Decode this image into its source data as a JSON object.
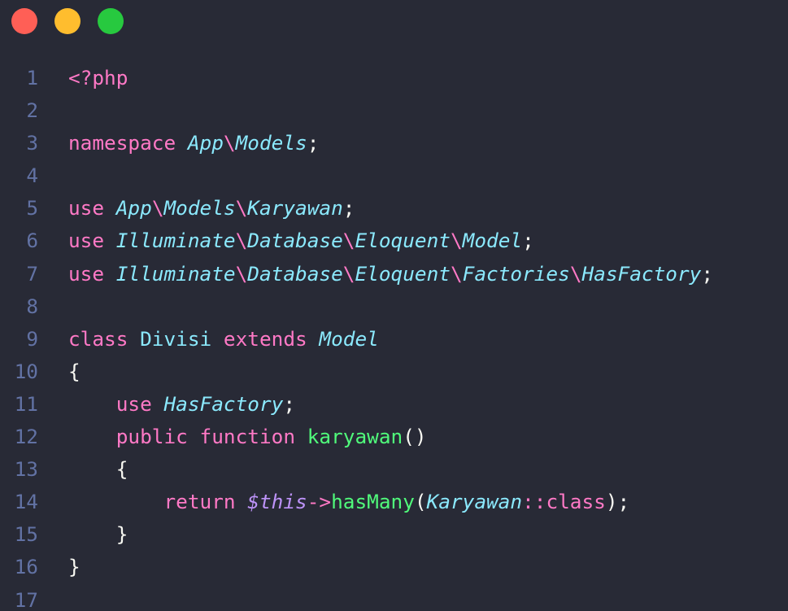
{
  "window": {
    "controls": [
      {
        "name": "close",
        "color": "#ff5f56"
      },
      {
        "name": "minimize",
        "color": "#ffbd2e"
      },
      {
        "name": "maximize",
        "color": "#27c93f"
      }
    ]
  },
  "theme": {
    "background": "#282a36",
    "line_number": "#6272a4",
    "keyword": "#ff79c6",
    "type": "#8be9fd",
    "function": "#50fa7b",
    "variable": "#bd93f9",
    "plain": "#f8f8f2"
  },
  "code": {
    "lines": [
      {
        "n": "1",
        "tokens": [
          {
            "t": "<?php",
            "k": "keyword"
          }
        ]
      },
      {
        "n": "2",
        "tokens": []
      },
      {
        "n": "3",
        "tokens": [
          {
            "t": "namespace ",
            "k": "keyword"
          },
          {
            "t": "App",
            "k": "type",
            "i": true
          },
          {
            "t": "\\",
            "k": "keyword"
          },
          {
            "t": "Models",
            "k": "type",
            "i": true
          },
          {
            "t": ";",
            "k": "plain"
          }
        ]
      },
      {
        "n": "4",
        "tokens": []
      },
      {
        "n": "5",
        "tokens": [
          {
            "t": "use ",
            "k": "keyword"
          },
          {
            "t": "App",
            "k": "type",
            "i": true
          },
          {
            "t": "\\",
            "k": "keyword"
          },
          {
            "t": "Models",
            "k": "type",
            "i": true
          },
          {
            "t": "\\",
            "k": "keyword"
          },
          {
            "t": "Karyawan",
            "k": "type",
            "i": true
          },
          {
            "t": ";",
            "k": "plain"
          }
        ]
      },
      {
        "n": "6",
        "tokens": [
          {
            "t": "use ",
            "k": "keyword"
          },
          {
            "t": "Illuminate",
            "k": "type",
            "i": true
          },
          {
            "t": "\\",
            "k": "keyword"
          },
          {
            "t": "Database",
            "k": "type",
            "i": true
          },
          {
            "t": "\\",
            "k": "keyword"
          },
          {
            "t": "Eloquent",
            "k": "type",
            "i": true
          },
          {
            "t": "\\",
            "k": "keyword"
          },
          {
            "t": "Model",
            "k": "type",
            "i": true
          },
          {
            "t": ";",
            "k": "plain"
          }
        ]
      },
      {
        "n": "7",
        "tokens": [
          {
            "t": "use ",
            "k": "keyword"
          },
          {
            "t": "Illuminate",
            "k": "type",
            "i": true
          },
          {
            "t": "\\",
            "k": "keyword"
          },
          {
            "t": "Database",
            "k": "type",
            "i": true
          },
          {
            "t": "\\",
            "k": "keyword"
          },
          {
            "t": "Eloquent",
            "k": "type",
            "i": true
          },
          {
            "t": "\\",
            "k": "keyword"
          },
          {
            "t": "Factories",
            "k": "type",
            "i": true
          },
          {
            "t": "\\",
            "k": "keyword"
          },
          {
            "t": "HasFactory",
            "k": "type",
            "i": true
          },
          {
            "t": ";",
            "k": "plain"
          }
        ]
      },
      {
        "n": "8",
        "tokens": []
      },
      {
        "n": "9",
        "tokens": [
          {
            "t": "class ",
            "k": "keyword"
          },
          {
            "t": "Divisi ",
            "k": "type"
          },
          {
            "t": "extends ",
            "k": "keyword"
          },
          {
            "t": "Model",
            "k": "type",
            "i": true
          }
        ]
      },
      {
        "n": "10",
        "tokens": [
          {
            "t": "{",
            "k": "plain"
          }
        ]
      },
      {
        "n": "11",
        "tokens": [
          {
            "t": "    ",
            "k": "plain"
          },
          {
            "t": "use ",
            "k": "keyword"
          },
          {
            "t": "HasFactory",
            "k": "type",
            "i": true
          },
          {
            "t": ";",
            "k": "plain"
          }
        ]
      },
      {
        "n": "12",
        "tokens": [
          {
            "t": "    ",
            "k": "plain"
          },
          {
            "t": "public ",
            "k": "keyword"
          },
          {
            "t": "function ",
            "k": "keyword"
          },
          {
            "t": "karyawan",
            "k": "function"
          },
          {
            "t": "()",
            "k": "plain"
          }
        ]
      },
      {
        "n": "13",
        "tokens": [
          {
            "t": "    ",
            "k": "plain"
          },
          {
            "t": "{",
            "k": "plain"
          }
        ]
      },
      {
        "n": "14",
        "tokens": [
          {
            "t": "        ",
            "k": "plain"
          },
          {
            "t": "return ",
            "k": "keyword"
          },
          {
            "t": "$this",
            "k": "variable",
            "i": true
          },
          {
            "t": "->",
            "k": "keyword"
          },
          {
            "t": "hasMany",
            "k": "function"
          },
          {
            "t": "(",
            "k": "plain"
          },
          {
            "t": "Karyawan",
            "k": "type",
            "i": true
          },
          {
            "t": "::",
            "k": "keyword"
          },
          {
            "t": "class",
            "k": "keyword"
          },
          {
            "t": ");",
            "k": "plain"
          }
        ]
      },
      {
        "n": "15",
        "tokens": [
          {
            "t": "    ",
            "k": "plain"
          },
          {
            "t": "}",
            "k": "plain"
          }
        ]
      },
      {
        "n": "16",
        "tokens": [
          {
            "t": "}",
            "k": "plain"
          }
        ]
      },
      {
        "n": "17",
        "tokens": []
      }
    ]
  }
}
